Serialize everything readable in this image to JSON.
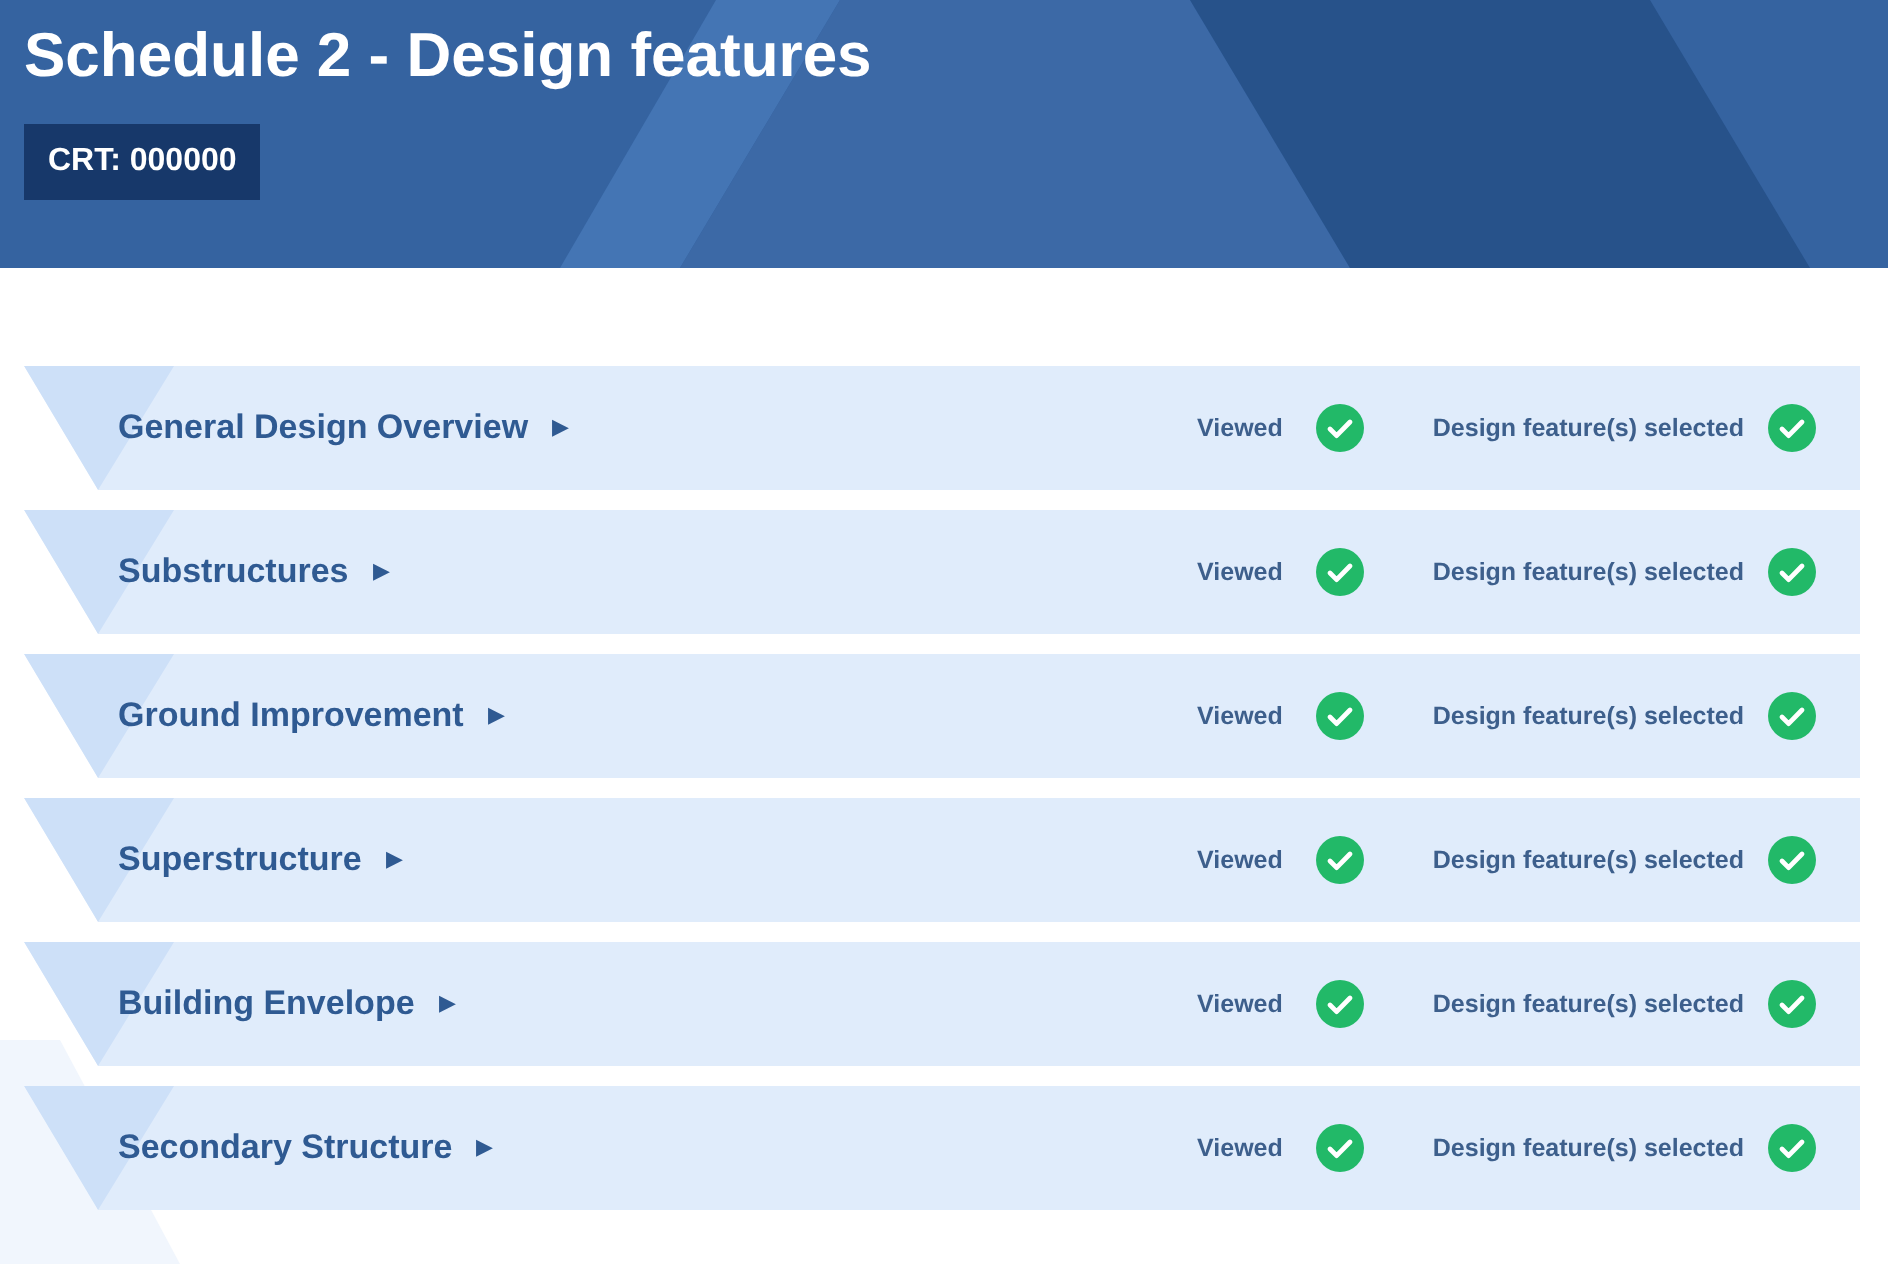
{
  "header": {
    "title": "Schedule 2 - Design features",
    "badge": "CRT: 000000"
  },
  "sections": [
    {
      "title": "General Design Overview",
      "arrow": "▶",
      "viewed_label": "Viewed",
      "viewed": true,
      "selected_label": "Design feature(s) selected",
      "features_selected": true
    },
    {
      "title": "Substructures",
      "arrow": "▶",
      "viewed_label": "Viewed",
      "viewed": true,
      "selected_label": "Design feature(s) selected",
      "features_selected": true
    },
    {
      "title": "Ground Improvement",
      "arrow": "▶",
      "viewed_label": "Viewed",
      "viewed": true,
      "selected_label": "Design feature(s) selected",
      "features_selected": true
    },
    {
      "title": "Superstructure",
      "arrow": "▶",
      "viewed_label": "Viewed",
      "viewed": true,
      "selected_label": "Design feature(s) selected",
      "features_selected": true
    },
    {
      "title": "Building Envelope",
      "arrow": "▶",
      "viewed_label": "Viewed",
      "viewed": true,
      "selected_label": "Design feature(s) selected",
      "features_selected": true
    },
    {
      "title": "Secondary Structure",
      "arrow": "▶",
      "viewed_label": "Viewed",
      "viewed": true,
      "selected_label": "Design feature(s) selected",
      "features_selected": true
    }
  ]
}
